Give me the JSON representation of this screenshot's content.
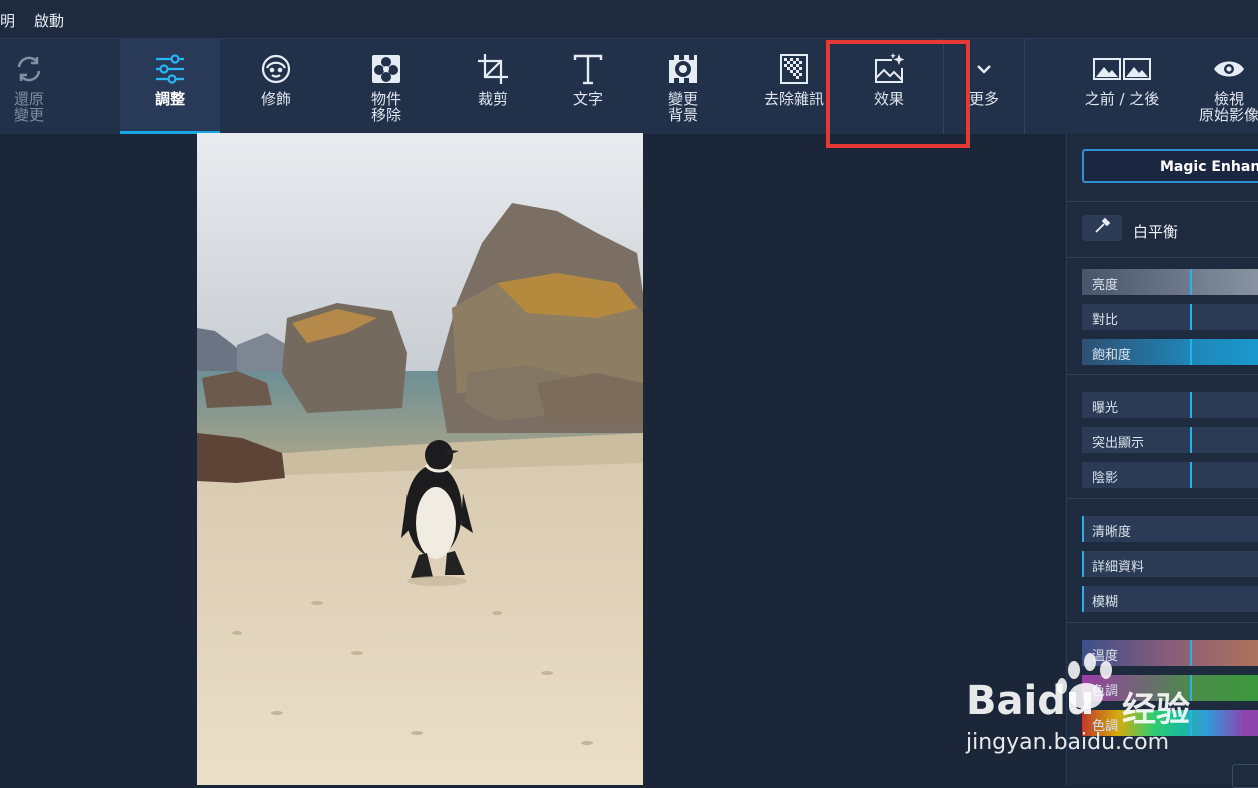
{
  "menu": {
    "items": [
      "明",
      "啟動"
    ]
  },
  "toolbar": {
    "undo": "還原\n變更",
    "adjust": "調整",
    "retouch": "修飾",
    "object_removal": "物件\n移除",
    "crop": "裁剪",
    "text": "文字",
    "change_bg": "變更\n背景",
    "denoise": "去除雜訊",
    "effects": "效果",
    "more": "更多",
    "before_after": "之前 / 之後",
    "view_original": "檢視\n原始影像"
  },
  "panel": {
    "magic_enhance": "Magic Enhance",
    "white_balance": "白平衡",
    "sliders": [
      {
        "label": "亮度",
        "value": 0.6
      },
      {
        "label": "對比",
        "value": 0.6
      },
      {
        "label": "飽和度",
        "value": 0.6
      },
      {
        "label": "曝光",
        "value": 0.6
      },
      {
        "label": "突出顯示",
        "value": 0.6
      },
      {
        "label": "陰影",
        "value": 0.6
      },
      {
        "label": "清晰度",
        "value": 0.0
      },
      {
        "label": "詳細資料",
        "value": 0.0
      },
      {
        "label": "模糊",
        "value": 0.0
      },
      {
        "label": "溫度",
        "value": 0.6
      },
      {
        "label": "色調",
        "value": 0.6
      },
      {
        "label": "色調",
        "value": 0.6
      }
    ]
  },
  "watermark": {
    "brand": "Baidu",
    "cn": "经验",
    "url": "jingyan.baidu.com"
  },
  "colors": {
    "accent": "#17a6e6",
    "highlight": "#e53935",
    "background": "#1b2638"
  }
}
